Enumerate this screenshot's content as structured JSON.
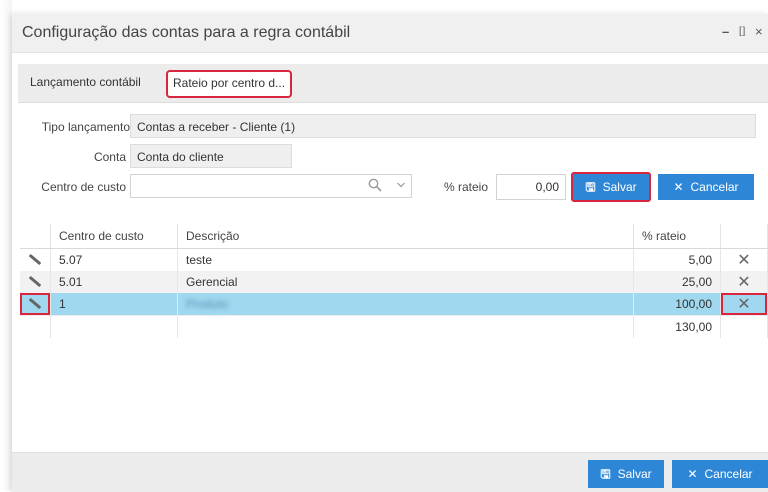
{
  "window": {
    "title": "Configuração das contas para a regra contábil",
    "minimize": "–",
    "maximize": "[ ]",
    "close": "×"
  },
  "tabs": [
    {
      "label": "Lançamento contábil",
      "active": false
    },
    {
      "label": "Rateio por centro d...",
      "active": true
    }
  ],
  "form": {
    "tipo_label": "Tipo lançamento",
    "tipo_value": "Contas a receber - Cliente (1)",
    "conta_label": "Conta",
    "conta_value": "Conta do cliente",
    "centro_label": "Centro de custo",
    "centro_value": "",
    "rateio_label": "% rateio",
    "rateio_value": "0,00",
    "save_label": "Salvar",
    "cancel_label": "Cancelar"
  },
  "grid": {
    "headers": [
      "Centro de custo",
      "Descrição",
      "% rateio"
    ],
    "rows": [
      {
        "centro": "5.07",
        "descricao": "teste",
        "rateio": "5,00"
      },
      {
        "centro": "5.01",
        "descricao": "Gerencial",
        "rateio": "25,00"
      },
      {
        "centro": "1",
        "descricao": "Produto",
        "rateio": "100,00"
      }
    ],
    "total": "130,00"
  },
  "footer": {
    "save_label": "Salvar",
    "cancel_label": "Cancelar"
  },
  "colors": {
    "accent": "#2e87d6",
    "highlight": "#d7263d",
    "selected_row": "#9fd8ef"
  }
}
